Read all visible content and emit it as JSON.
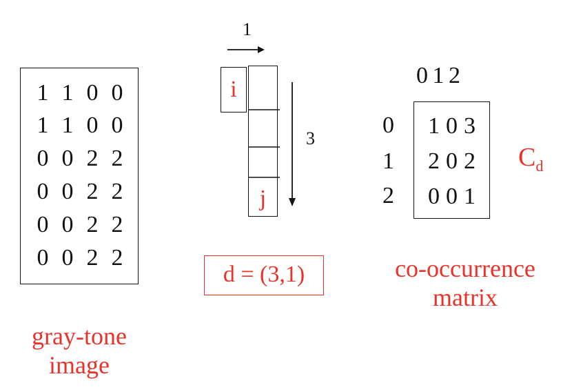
{
  "gray_tone": {
    "rows": [
      [
        "1",
        "1",
        "0",
        "0"
      ],
      [
        "1",
        "1",
        "0",
        "0"
      ],
      [
        "0",
        "0",
        "2",
        "2"
      ],
      [
        "0",
        "0",
        "2",
        "2"
      ],
      [
        "0",
        "0",
        "2",
        "2"
      ],
      [
        "0",
        "0",
        "2",
        "2"
      ]
    ],
    "caption_line1": "gray-tone",
    "caption_line2": "image"
  },
  "displacement": {
    "col_step": "1",
    "row_step": "3",
    "pixel_i": "i",
    "pixel_j": "j",
    "label": "d = (3,1)"
  },
  "cooccurrence": {
    "col_header": "0 1 2",
    "row_labels": [
      "0",
      "1",
      "2"
    ],
    "rows": [
      [
        "1",
        "0",
        "3"
      ],
      [
        "2",
        "0",
        "2"
      ],
      [
        "0",
        "0",
        "1"
      ]
    ],
    "symbol_main": "C",
    "symbol_sub": "d",
    "caption_line1": "co-occurrence",
    "caption_line2": "matrix"
  },
  "colors": {
    "accent": "#e8332a",
    "ink": "#111111"
  }
}
